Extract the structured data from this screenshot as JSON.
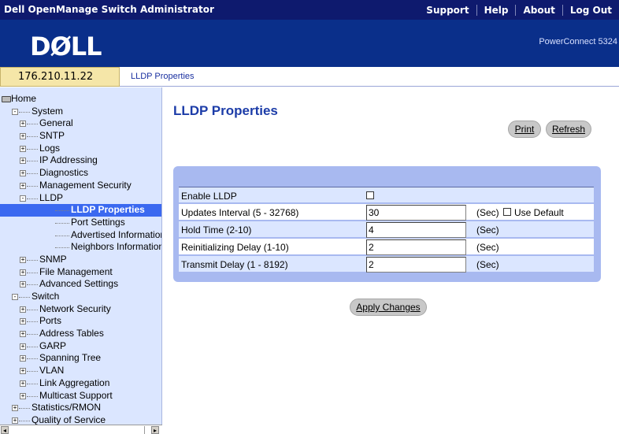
{
  "header": {
    "app_title": "Dell OpenManage Switch Administrator",
    "nav": [
      "Support",
      "Help",
      "About",
      "Log Out"
    ],
    "logo": "DØLL",
    "model": "PowerConnect 5324"
  },
  "ip_address": "176.210.11.22",
  "breadcrumb": "LLDP Properties",
  "sidebar": {
    "items": [
      {
        "label": "Home",
        "level": 0,
        "expander": "",
        "home": true
      },
      {
        "label": "System",
        "level": 1,
        "expander": "-"
      },
      {
        "label": "General",
        "level": 2,
        "expander": "+"
      },
      {
        "label": "SNTP",
        "level": 2,
        "expander": "+"
      },
      {
        "label": "Logs",
        "level": 2,
        "expander": "+"
      },
      {
        "label": "IP Addressing",
        "level": 2,
        "expander": "+"
      },
      {
        "label": "Diagnostics",
        "level": 2,
        "expander": "+"
      },
      {
        "label": "Management Security",
        "level": 2,
        "expander": "+"
      },
      {
        "label": "LLDP",
        "level": 2,
        "expander": "-"
      },
      {
        "label": "LLDP Properties",
        "level": 3,
        "expander": "",
        "selected": true
      },
      {
        "label": "Port Settings",
        "level": 3,
        "expander": ""
      },
      {
        "label": "Advertised Information",
        "level": 3,
        "expander": ""
      },
      {
        "label": "Neighbors Information",
        "level": 3,
        "expander": ""
      },
      {
        "label": "SNMP",
        "level": 2,
        "expander": "+"
      },
      {
        "label": "File Management",
        "level": 2,
        "expander": "+"
      },
      {
        "label": "Advanced Settings",
        "level": 2,
        "expander": "+"
      },
      {
        "label": "Switch",
        "level": 1,
        "expander": "-"
      },
      {
        "label": "Network Security",
        "level": 2,
        "expander": "+"
      },
      {
        "label": "Ports",
        "level": 2,
        "expander": "+"
      },
      {
        "label": "Address Tables",
        "level": 2,
        "expander": "+"
      },
      {
        "label": "GARP",
        "level": 2,
        "expander": "+"
      },
      {
        "label": "Spanning Tree",
        "level": 2,
        "expander": "+"
      },
      {
        "label": "VLAN",
        "level": 2,
        "expander": "+"
      },
      {
        "label": "Link Aggregation",
        "level": 2,
        "expander": "+"
      },
      {
        "label": "Multicast Support",
        "level": 2,
        "expander": "+"
      },
      {
        "label": "Statistics/RMON",
        "level": 1,
        "expander": "+"
      },
      {
        "label": "Quality of Service",
        "level": 1,
        "expander": "+"
      }
    ]
  },
  "main": {
    "title": "LLDP Properties",
    "print_label": "Print",
    "refresh_label": "Refresh",
    "apply_label": "Apply Changes",
    "enable_label": "Enable LLDP",
    "enable_checked": false,
    "use_default_label": "Use Default",
    "use_default_checked": false,
    "fields": [
      {
        "label": "Updates Interval (5 - 32768)",
        "value": "30",
        "unit": "(Sec)"
      },
      {
        "label": "Hold Time (2-10)",
        "value": "4",
        "unit": "(Sec)"
      },
      {
        "label": "Reinitializing Delay  (1-10)",
        "value": "2",
        "unit": "(Sec)"
      },
      {
        "label": "Transmit Delay (1 - 8192)",
        "value": "2",
        "unit": "(Sec)"
      }
    ]
  },
  "colors": {
    "topbar": "#0e1a6e",
    "brand": "#0a2f8a",
    "sidebar_bg": "#dbe6ff",
    "selected": "#3b69f0",
    "panel": "#a8b9f0",
    "title": "#1c3ca8"
  }
}
